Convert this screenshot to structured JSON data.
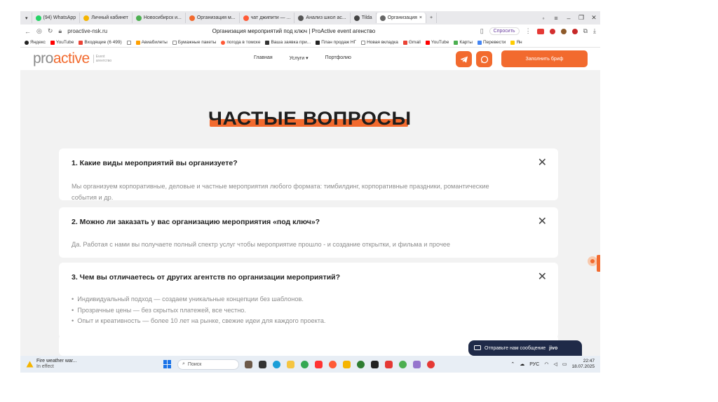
{
  "browser": {
    "tabs": [
      {
        "label": "(94) WhatsApp",
        "color": "#25d366"
      },
      {
        "label": "Личный кабинет",
        "color": "#f5b400"
      },
      {
        "label": "Новосибирск и...",
        "color": "#4caf50"
      },
      {
        "label": "Организация м...",
        "color": "#f26a2e"
      },
      {
        "label": "чат джипити — ...",
        "color": "#ff5a36"
      },
      {
        "label": "Анализ школ ас...",
        "color": "#555555"
      },
      {
        "label": "Tilda",
        "color": "#444444"
      },
      {
        "label": "Организация",
        "color": "#666666",
        "active": true
      }
    ],
    "address": "proactive-nsk.ru",
    "page_title": "Организация мероприятий под ключ | ProActive event агенство",
    "ask_label": "Спросить"
  },
  "bookmarks": [
    {
      "label": "Яндекс",
      "color": "#ff3333"
    },
    {
      "label": "YouTube",
      "color": "#ff0000"
    },
    {
      "label": "Входящие (6 499)",
      "color": "#ea4335"
    },
    {
      "label": "",
      "color": "#888888"
    },
    {
      "label": "Авиабилеты",
      "color": "#ffa000"
    },
    {
      "label": "Бумажные пакеты",
      "color": "#888888"
    },
    {
      "label": "погода в томске",
      "color": "#ff5a36"
    },
    {
      "label": "Ваша заявка при...",
      "color": "#333333"
    },
    {
      "label": "План продаж НГ",
      "color": "#222222"
    },
    {
      "label": "Новая вкладка",
      "color": "#888888"
    },
    {
      "label": "Gmail",
      "color": "#ea4335"
    },
    {
      "label": "YouTube",
      "color": "#ff0000"
    },
    {
      "label": "Карты",
      "color": "#4caf50"
    },
    {
      "label": "Перевести",
      "color": "#4285f4"
    },
    {
      "label": "Ян",
      "color": "#ffcc00"
    }
  ],
  "site": {
    "logo_pro": "pro",
    "logo_active": "active",
    "logo_sub_1": "Event",
    "logo_sub_2": "агентство",
    "nav": {
      "home": "Главная",
      "services": "Услуги",
      "portfolio": "Портфолио"
    },
    "brief_button": "Заполнить бриф",
    "accent": "#f26a2e"
  },
  "faq": {
    "heading": "ЧАСТЫЕ ВОПРОСЫ",
    "items": [
      {
        "question": "1. Какие виды мероприятий вы организуете?",
        "answer_line_1": "Мы организуем корпоративные, деловые и частные мероприятия любого формата: тимбилдинг, корпоративные праздники, романтические",
        "answer_line_2": "события и др."
      },
      {
        "question": "2. Можно ли заказать у вас организацию мероприятия «под ключ»?",
        "answer": "Да. Работая с нами вы получаете полный спектр услуг чтобы мероприятие прошло - и создание открытки, и фильма и прочее"
      },
      {
        "question": "3. Чем вы отличаетесь от других агентств по организации мероприятий?",
        "bullets": [
          "Индивидуальный подход — создаем уникальные концепции без шаблонов.",
          "Прозрачные цены — без скрытых платежей, все честно.",
          "Опыт и креативность — более 10 лет на рынке, свежие идеи для каждого проекта."
        ]
      }
    ]
  },
  "jivo": {
    "label": "Отправьте нам сообщение",
    "brand": "jivo"
  },
  "taskbar": {
    "weather_line_1": "Fire weather war...",
    "weather_line_2": "In effect",
    "search_placeholder": "Поиск",
    "lang": "РУС",
    "time": "22:47",
    "date": "18.07.2025"
  }
}
